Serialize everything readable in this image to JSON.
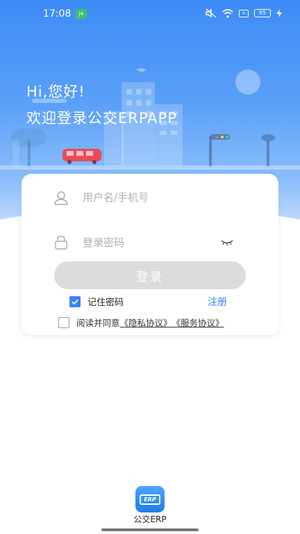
{
  "status_bar": {
    "time": "17:08",
    "notification_badge": "J4",
    "x_box": "×",
    "battery_level": "85"
  },
  "header": {
    "greeting": "Hi,您好!",
    "welcome": "欢迎登录公交ERPAPP",
    "bg_color_top": "#3d8bf7"
  },
  "login_form": {
    "username_placeholder": "用户名/手机号",
    "password_placeholder": "登录密码",
    "login_button": "登录",
    "remember_label": "记住密码",
    "remember_checked": true,
    "register_link": "注册",
    "agree_prefix": "阅读并同意",
    "privacy_link": "《隐私协议》",
    "service_link": "《服务协议》",
    "agree_checked": false
  },
  "footer": {
    "app_icon_text": "ERP",
    "app_name": "公交ERP"
  },
  "colors": {
    "accent": "#3b82f6",
    "button_disabled": "#dcdcdc"
  }
}
